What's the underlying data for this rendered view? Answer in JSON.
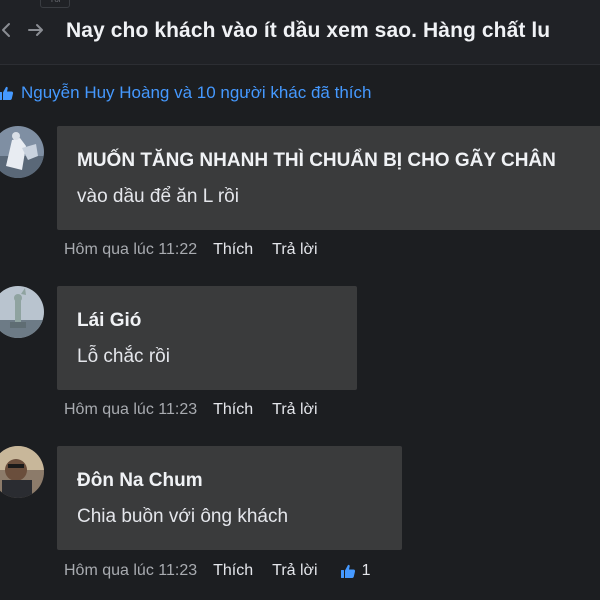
{
  "header": {
    "tab_stub": "Tôi",
    "title": "Nay cho khách vào ít dầu xem sao. Hàng chất lu"
  },
  "likes": {
    "text": "Nguyễn Huy Hoàng và 10 người khác đã thích"
  },
  "comments": [
    {
      "author": "MUỐN TĂNG NHANH THÌ CHUẨN BỊ CHO GÃY CHÂN",
      "text": "vào dầu để ăn L rồi",
      "time": "Hôm qua lúc 11:22",
      "like_label": "Thích",
      "reply_label": "Trả lời"
    },
    {
      "author": "Lái Gió",
      "text": "Lỗ chắc rồi",
      "time": "Hôm qua lúc 11:23",
      "like_label": "Thích",
      "reply_label": "Trả lời"
    },
    {
      "author": "Đôn Na Chum",
      "text": "Chia buồn với ông khách",
      "time": "Hôm qua lúc 11:23",
      "like_label": "Thích",
      "reply_label": "Trả lời",
      "reactions": "1"
    }
  ],
  "colors": {
    "background": "#1c1e21",
    "bubble": "#3a3b3c",
    "link_blue": "#4599ff",
    "meta_gray": "#a8abb0"
  }
}
